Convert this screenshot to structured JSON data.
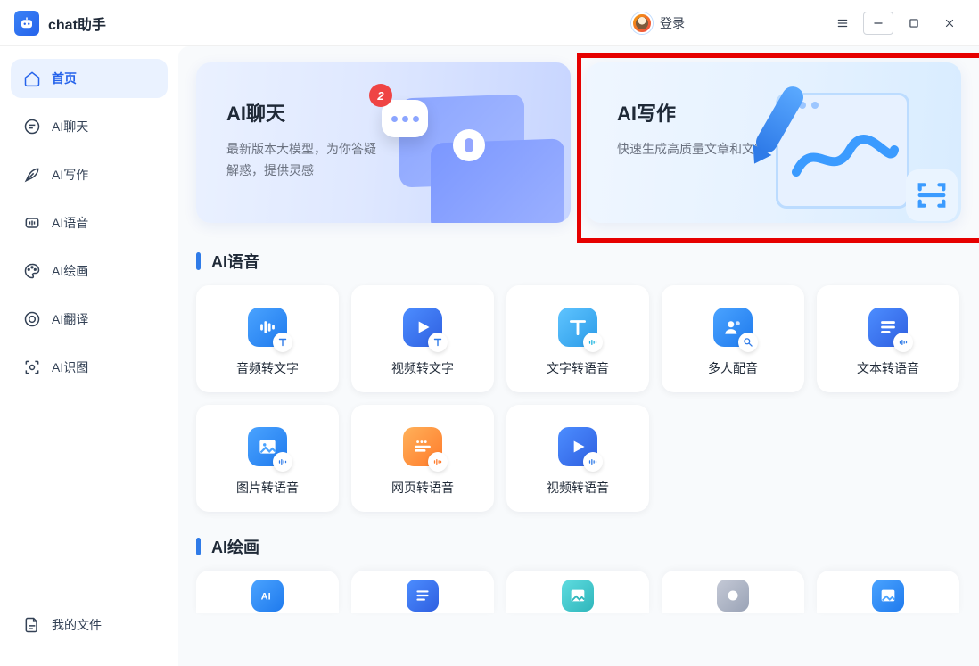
{
  "header": {
    "app_title": "chat助手",
    "login_label": "登录"
  },
  "sidebar": {
    "items": [
      {
        "label": "首页"
      },
      {
        "label": "AI聊天"
      },
      {
        "label": "AI写作"
      },
      {
        "label": "AI语音"
      },
      {
        "label": "AI绘画"
      },
      {
        "label": "AI翻译"
      },
      {
        "label": "AI识图"
      }
    ],
    "footer": {
      "label": "我的文件"
    }
  },
  "hero": {
    "chat": {
      "title": "AI聊天",
      "desc": "最新版本大模型，为你答疑解惑，提供灵感",
      "badge": "2"
    },
    "write": {
      "title": "AI写作",
      "desc": "快速生成高质量文章和文案"
    }
  },
  "sections": {
    "voice": {
      "title": "AI语音",
      "tools": [
        {
          "label": "音频转文字"
        },
        {
          "label": "视频转文字"
        },
        {
          "label": "文字转语音"
        },
        {
          "label": "多人配音"
        },
        {
          "label": "文本转语音"
        },
        {
          "label": "图片转语音"
        },
        {
          "label": "网页转语音"
        },
        {
          "label": "视频转语音"
        }
      ]
    },
    "draw": {
      "title": "AI绘画"
    }
  }
}
